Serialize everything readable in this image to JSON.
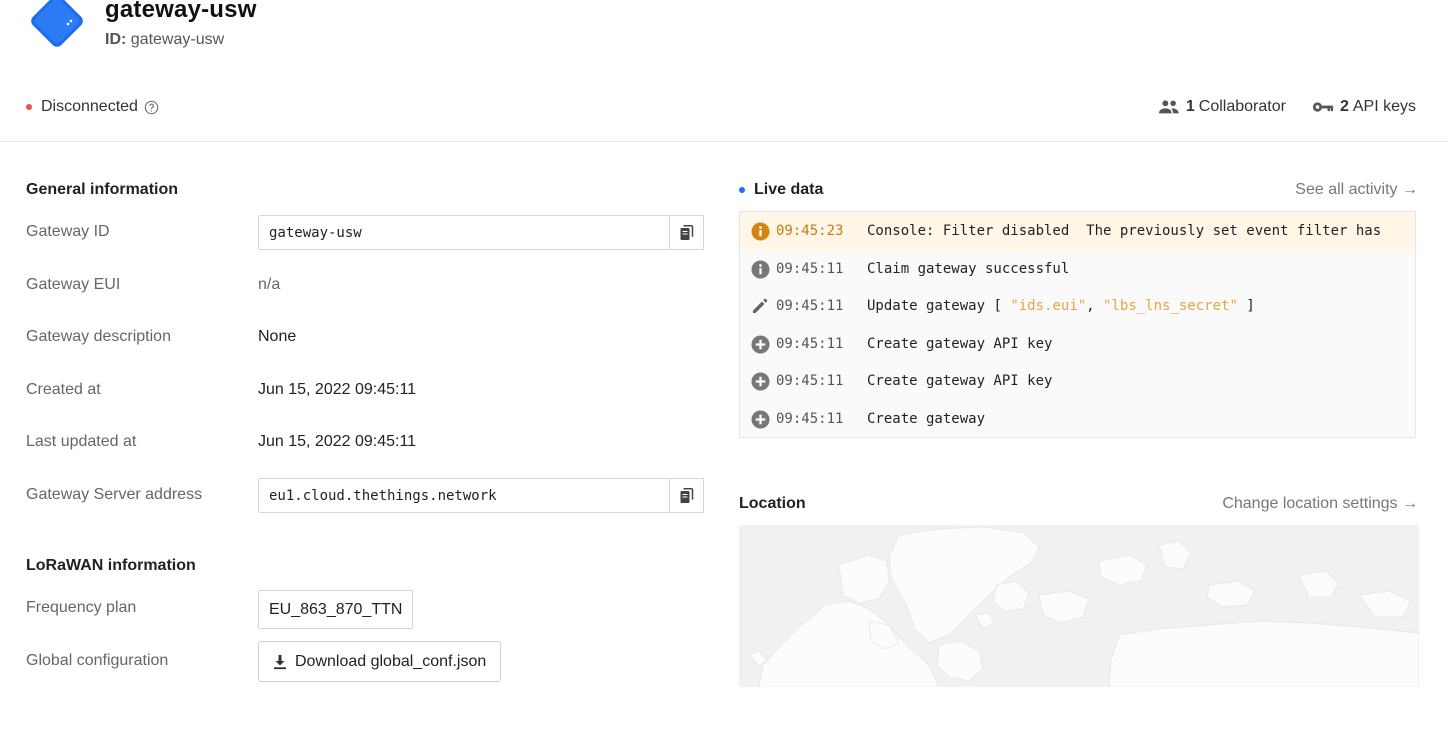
{
  "gateway": {
    "title": "gateway-usw",
    "id_label": "ID:",
    "id_value": "gateway-usw",
    "brand_color": "#1a6cf0"
  },
  "status": {
    "text": "Disconnected",
    "color": "#e8524f"
  },
  "header_right": {
    "collaborators_count": "1",
    "collaborators_label": "Collaborator",
    "api_keys_count": "2",
    "api_keys_label": "API keys"
  },
  "general": {
    "title": "General information",
    "rows": {
      "gateway_id_label": "Gateway ID",
      "gateway_id_value": "gateway-usw",
      "eui_label": "Gateway EUI",
      "eui_value": "n/a",
      "description_label": "Gateway description",
      "description_value": "None",
      "created_label": "Created at",
      "created_value": "Jun 15, 2022 09:45:11",
      "updated_label": "Last updated at",
      "updated_value": "Jun 15, 2022 09:45:11",
      "server_label": "Gateway Server address",
      "server_value": "eu1.cloud.thethings.network"
    }
  },
  "lorawan": {
    "title": "LoRaWAN information",
    "frequency_label": "Frequency plan",
    "frequency_value": "EU_863_870_TTN",
    "global_label": "Global configuration",
    "download_label": "Download global_conf.json"
  },
  "live": {
    "title": "Live data",
    "see_all": "See all activity →",
    "events": [
      {
        "icon": "info-warning-icon",
        "time": "09:45:23",
        "text": "Console: Filter disabled  The previously set event filter has"
      },
      {
        "icon": "info-icon",
        "time": "09:45:11",
        "text": "Claim gateway successful"
      },
      {
        "icon": "edit-icon",
        "time": "09:45:11",
        "text": "Update gateway",
        "pre": " [ ",
        "field1": "\"ids.eui\"",
        "sep": ", ",
        "field2": "\"lbs_lns_secret\"",
        "post": " ]"
      },
      {
        "icon": "add-circle-icon",
        "time": "09:45:11",
        "text": "Create gateway API key"
      },
      {
        "icon": "add-circle-icon",
        "time": "09:45:11",
        "text": "Create gateway API key"
      },
      {
        "icon": "add-circle-icon",
        "time": "09:45:11",
        "text": "Create gateway"
      }
    ]
  },
  "location": {
    "title": "Location",
    "change_link": "Change location settings →"
  }
}
